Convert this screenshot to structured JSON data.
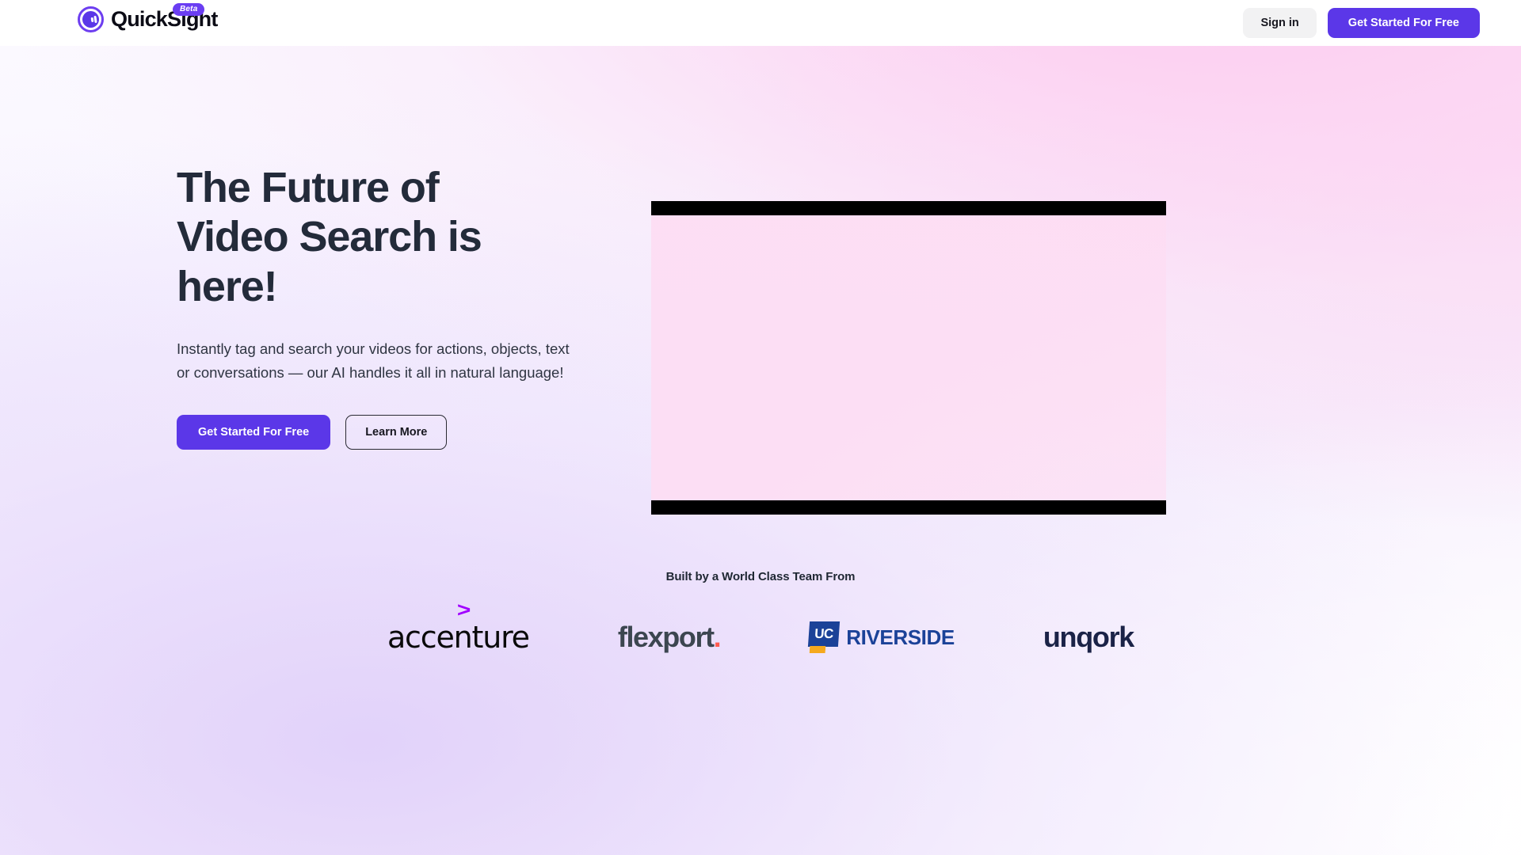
{
  "header": {
    "brand_name": "QuickSight",
    "brand_icon": "camera-lens-icon",
    "beta_badge": "Beta",
    "signin_label": "Sign in",
    "get_started_label": "Get Started For Free",
    "background": "#ffffff"
  },
  "hero": {
    "headline": "The Future of\nVideo Search is\nhere!",
    "subtext": "Instantly tag and search your videos for actions, objects, text or conversations — our AI handles it all in natural language!",
    "primary_cta": "Get Started For Free",
    "secondary_cta": "Learn More",
    "video": {
      "state": "unloaded",
      "letterbox_color": "#000000",
      "screen_color": "#fddef3"
    }
  },
  "partners": {
    "heading": "Built by a World Class Team From",
    "logos": [
      {
        "name": "accenture",
        "word": "accenture",
        "accent_glyph": ">",
        "accent_color": "#a100ff",
        "text_color": "#0a0a0a"
      },
      {
        "name": "flexport",
        "word": "flexport",
        "accent_glyph": ".",
        "accent_color": "#ff5a4e",
        "text_color": "#3c4650"
      },
      {
        "name": "uc-riverside",
        "mark_text": "UC",
        "word": "RIVERSIDE",
        "accent_color": "#f5a91e",
        "text_color": "#1b4298"
      },
      {
        "name": "unqork",
        "word": "unqork",
        "text_color": "#1b2347"
      }
    ]
  },
  "theme": {
    "brand_purple": "#5b37e8",
    "logo_ring": "#6d3ef0",
    "headline_color": "#232b3a",
    "body_text_color": "#2f3542",
    "signin_bg": "#f2f2f3",
    "gradient_pink": "#fcc8ee",
    "gradient_lavender": "#decdf9",
    "gradient_base": "#fbf9ff"
  }
}
